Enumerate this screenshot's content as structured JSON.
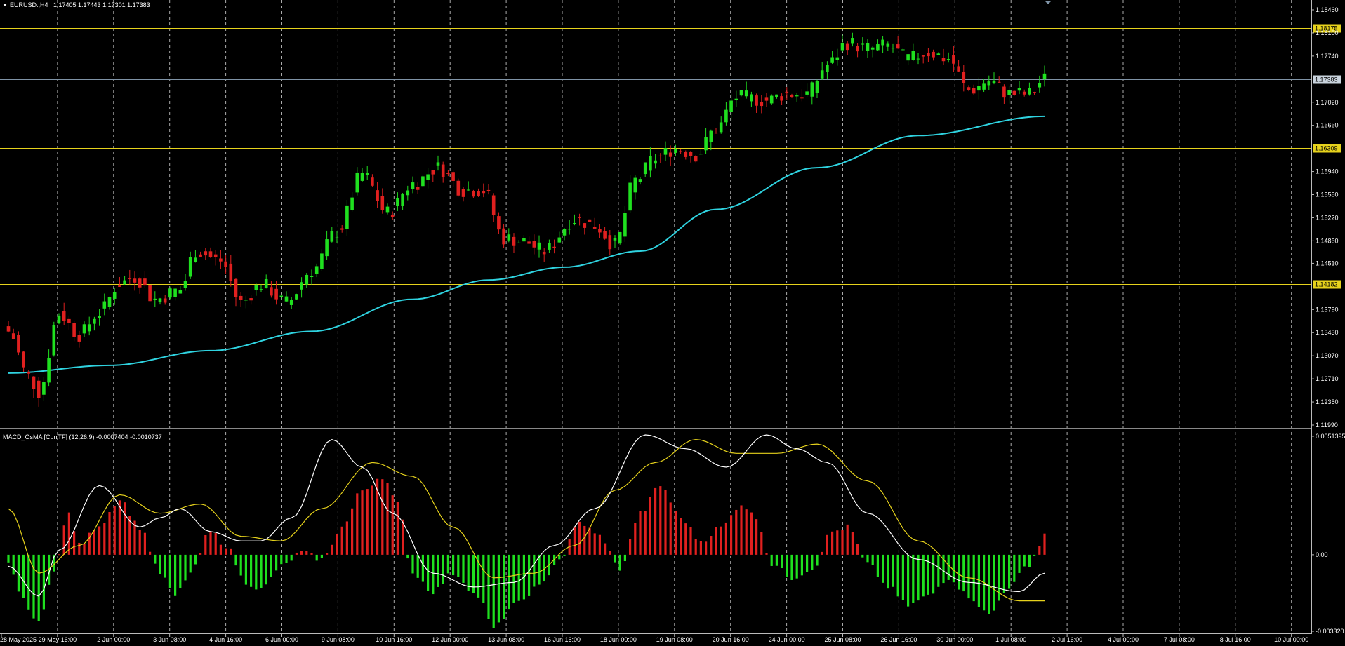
{
  "chart_header": {
    "symbol_label": "EURUSD.,H4",
    "ohlc_text": "1.17405 1.17443 1.17301 1.17383"
  },
  "indicator_header": {
    "label": "MACD_OsMA [CurrTF] (12,26,9) -0.0007404 -0.0010737"
  },
  "colors": {
    "background": "#000000",
    "bull_candle": "#1fe01f",
    "bear_candle": "#e0201f",
    "moving_average": "#2fd3e0",
    "level_line": "#e6d21c",
    "current_price_line": "#7f93a6",
    "grid": "#c8c8c8",
    "macd_line": "#ffffff",
    "signal_line": "#e6d21c",
    "hist_positive": "#e0201f",
    "hist_negative": "#1fe01f"
  },
  "chart_data": [
    {
      "type": "candlestick",
      "title": "EURUSD.,H4",
      "ylim": [
        1.1199,
        1.1846
      ],
      "y_ticks": [
        "1.18460",
        "1.18100",
        "1.17740",
        "1.17020",
        "1.16660",
        "1.15940",
        "1.15580",
        "1.15220",
        "1.14860",
        "1.14510",
        "1.13790",
        "1.13430",
        "1.13070",
        "1.12710",
        "1.12350",
        "1.11990"
      ],
      "horizontal_levels": [
        {
          "label": "1.18175",
          "value": 1.18175
        },
        {
          "label": "1.16309",
          "value": 1.16309
        },
        {
          "label": "1.14182",
          "value": 1.14182
        }
      ],
      "current_price": {
        "label": "1.17383",
        "value": 1.17383
      },
      "x_labels": [
        "28 May 2025",
        "29 May 16:00",
        "2 Jun 00:00",
        "3 Jun 08:00",
        "4 Jun 16:00",
        "6 Jun 00:00",
        "9 Jun 08:00",
        "10 Jun 16:00",
        "12 Jun 00:00",
        "13 Jun 08:00",
        "16 Jun 16:00",
        "18 Jun 00:00",
        "19 Jun 08:00",
        "20 Jun 16:00",
        "24 Jun 00:00",
        "25 Jun 08:00",
        "26 Jun 16:00",
        "30 Jun 00:00",
        "1 Jul 08:00",
        "2 Jul 16:00",
        "4 Jul 00:00",
        "7 Jul 08:00",
        "8 Jul 16:00",
        "10 Jul 00:00"
      ],
      "close_anchors": [
        {
          "bar": 0,
          "close": 1.1345
        },
        {
          "bar": 4,
          "close": 1.1275
        },
        {
          "bar": 6,
          "close": 1.125
        },
        {
          "bar": 10,
          "close": 1.1372
        },
        {
          "bar": 14,
          "close": 1.134
        },
        {
          "bar": 18,
          "close": 1.1375
        },
        {
          "bar": 22,
          "close": 1.142
        },
        {
          "bar": 25,
          "close": 1.143
        },
        {
          "bar": 29,
          "close": 1.1395
        },
        {
          "bar": 34,
          "close": 1.141
        },
        {
          "bar": 37,
          "close": 1.147
        },
        {
          "bar": 42,
          "close": 1.1455
        },
        {
          "bar": 46,
          "close": 1.139
        },
        {
          "bar": 50,
          "close": 1.1418
        },
        {
          "bar": 55,
          "close": 1.139
        },
        {
          "bar": 60,
          "close": 1.144
        },
        {
          "bar": 65,
          "close": 1.15
        },
        {
          "bar": 70,
          "close": 1.159
        },
        {
          "bar": 75,
          "close": 1.153
        },
        {
          "bar": 80,
          "close": 1.1575
        },
        {
          "bar": 85,
          "close": 1.16
        },
        {
          "bar": 90,
          "close": 1.1565
        },
        {
          "bar": 94,
          "close": 1.1565
        },
        {
          "bar": 98,
          "close": 1.149
        },
        {
          "bar": 102,
          "close": 1.1485
        },
        {
          "bar": 106,
          "close": 1.147
        },
        {
          "bar": 112,
          "close": 1.152
        },
        {
          "bar": 116,
          "close": 1.151
        },
        {
          "bar": 120,
          "close": 1.148
        },
        {
          "bar": 124,
          "close": 1.158
        },
        {
          "bar": 128,
          "close": 1.1615
        },
        {
          "bar": 132,
          "close": 1.163
        },
        {
          "bar": 136,
          "close": 1.162
        },
        {
          "bar": 140,
          "close": 1.166
        },
        {
          "bar": 144,
          "close": 1.171
        },
        {
          "bar": 150,
          "close": 1.1705
        },
        {
          "bar": 154,
          "close": 1.1715
        },
        {
          "bar": 158,
          "close": 1.1715
        },
        {
          "bar": 162,
          "close": 1.176
        },
        {
          "bar": 166,
          "close": 1.1795
        },
        {
          "bar": 170,
          "close": 1.1785
        },
        {
          "bar": 174,
          "close": 1.179
        },
        {
          "bar": 178,
          "close": 1.177
        },
        {
          "bar": 182,
          "close": 1.178
        },
        {
          "bar": 186,
          "close": 1.177
        },
        {
          "bar": 190,
          "close": 1.172
        },
        {
          "bar": 194,
          "close": 1.1735
        },
        {
          "bar": 198,
          "close": 1.1715
        },
        {
          "bar": 202,
          "close": 1.1715
        },
        {
          "bar": 205,
          "close": 1.17383
        }
      ],
      "moving_average_anchors": [
        {
          "bar": 0,
          "value": 1.128
        },
        {
          "bar": 20,
          "value": 1.1292
        },
        {
          "bar": 40,
          "value": 1.1315
        },
        {
          "bar": 60,
          "value": 1.1345
        },
        {
          "bar": 80,
          "value": 1.1395
        },
        {
          "bar": 95,
          "value": 1.1425
        },
        {
          "bar": 110,
          "value": 1.1445
        },
        {
          "bar": 125,
          "value": 1.147
        },
        {
          "bar": 140,
          "value": 1.1535
        },
        {
          "bar": 160,
          "value": 1.16
        },
        {
          "bar": 180,
          "value": 1.165
        },
        {
          "bar": 205,
          "value": 1.168
        }
      ],
      "bar_count": 206
    },
    {
      "type": "histogram",
      "title": "MACD_OsMA [CurrTF] (12,26,9)",
      "ylim": [
        -0.00332,
        0.005139
      ],
      "y_ticks": [
        "0.0051395",
        "0.00",
        "-0.003320"
      ],
      "osma_anchors": [
        {
          "bar": 0,
          "value": -0.0004
        },
        {
          "bar": 3,
          "value": -0.002
        },
        {
          "bar": 6,
          "value": -0.003
        },
        {
          "bar": 9,
          "value": -0.0006
        },
        {
          "bar": 12,
          "value": 0.0018
        },
        {
          "bar": 14,
          "value": 0.0004
        },
        {
          "bar": 18,
          "value": 0.0013
        },
        {
          "bar": 22,
          "value": 0.0024
        },
        {
          "bar": 26,
          "value": 0.0012
        },
        {
          "bar": 30,
          "value": -0.0008
        },
        {
          "bar": 33,
          "value": -0.0018
        },
        {
          "bar": 36,
          "value": -0.0008
        },
        {
          "bar": 40,
          "value": 0.001
        },
        {
          "bar": 43,
          "value": 0.0004
        },
        {
          "bar": 47,
          "value": -0.0012
        },
        {
          "bar": 50,
          "value": -0.0015
        },
        {
          "bar": 54,
          "value": -0.0005
        },
        {
          "bar": 58,
          "value": 0.0001
        },
        {
          "bar": 62,
          "value": -0.0002
        },
        {
          "bar": 66,
          "value": 0.0012
        },
        {
          "bar": 70,
          "value": 0.0028
        },
        {
          "bar": 74,
          "value": 0.0034
        },
        {
          "bar": 77,
          "value": 0.0022
        },
        {
          "bar": 80,
          "value": -0.0008
        },
        {
          "bar": 84,
          "value": -0.0016
        },
        {
          "bar": 88,
          "value": -0.0008
        },
        {
          "bar": 93,
          "value": -0.0018
        },
        {
          "bar": 96,
          "value": -0.0032
        },
        {
          "bar": 100,
          "value": -0.0022
        },
        {
          "bar": 105,
          "value": -0.0014
        },
        {
          "bar": 109,
          "value": -0.0002
        },
        {
          "bar": 113,
          "value": 0.0014
        },
        {
          "bar": 117,
          "value": 0.0008
        },
        {
          "bar": 121,
          "value": -0.0006
        },
        {
          "bar": 125,
          "value": 0.0018
        },
        {
          "bar": 129,
          "value": 0.003
        },
        {
          "bar": 133,
          "value": 0.0016
        },
        {
          "bar": 137,
          "value": 0.0006
        },
        {
          "bar": 141,
          "value": 0.0012
        },
        {
          "bar": 145,
          "value": 0.0022
        },
        {
          "bar": 148,
          "value": 0.0016
        },
        {
          "bar": 151,
          "value": -0.0004
        },
        {
          "bar": 155,
          "value": -0.001
        },
        {
          "bar": 159,
          "value": -0.0006
        },
        {
          "bar": 163,
          "value": 0.001
        },
        {
          "bar": 166,
          "value": 0.0012
        },
        {
          "bar": 170,
          "value": -0.0004
        },
        {
          "bar": 174,
          "value": -0.0014
        },
        {
          "bar": 178,
          "value": -0.0022
        },
        {
          "bar": 182,
          "value": -0.0018
        },
        {
          "bar": 186,
          "value": -0.001
        },
        {
          "bar": 190,
          "value": -0.0018
        },
        {
          "bar": 194,
          "value": -0.0026
        },
        {
          "bar": 198,
          "value": -0.0014
        },
        {
          "bar": 202,
          "value": -0.0004
        },
        {
          "bar": 204,
          "value": 0.0004
        },
        {
          "bar": 205,
          "value": 0.0009
        }
      ],
      "macd_anchors": [
        {
          "bar": 0,
          "value": -0.0005
        },
        {
          "bar": 6,
          "value": -0.0018
        },
        {
          "bar": 10,
          "value": 0.0002
        },
        {
          "bar": 18,
          "value": 0.003
        },
        {
          "bar": 26,
          "value": 0.0012
        },
        {
          "bar": 30,
          "value": 0.0016
        },
        {
          "bar": 34,
          "value": 0.002
        },
        {
          "bar": 40,
          "value": 0.001
        },
        {
          "bar": 46,
          "value": 0.0006
        },
        {
          "bar": 50,
          "value": 0.0006
        },
        {
          "bar": 56,
          "value": 0.0016
        },
        {
          "bar": 64,
          "value": 0.005
        },
        {
          "bar": 70,
          "value": 0.0038
        },
        {
          "bar": 76,
          "value": 0.0018
        },
        {
          "bar": 84,
          "value": -0.0008
        },
        {
          "bar": 92,
          "value": -0.0014
        },
        {
          "bar": 100,
          "value": -0.0012
        },
        {
          "bar": 108,
          "value": 0.0004
        },
        {
          "bar": 116,
          "value": 0.002
        },
        {
          "bar": 126,
          "value": 0.0052
        },
        {
          "bar": 134,
          "value": 0.0046
        },
        {
          "bar": 142,
          "value": 0.0038
        },
        {
          "bar": 150,
          "value": 0.0052
        },
        {
          "bar": 156,
          "value": 0.0046
        },
        {
          "bar": 162,
          "value": 0.004
        },
        {
          "bar": 170,
          "value": 0.0018
        },
        {
          "bar": 180,
          "value": -0.0002
        },
        {
          "bar": 190,
          "value": -0.0012
        },
        {
          "bar": 200,
          "value": -0.0016
        },
        {
          "bar": 205,
          "value": -0.0008
        }
      ],
      "signal_anchors": [
        {
          "bar": 0,
          "value": 0.002
        },
        {
          "bar": 6,
          "value": -0.0008
        },
        {
          "bar": 14,
          "value": 0.0004
        },
        {
          "bar": 22,
          "value": 0.0026
        },
        {
          "bar": 30,
          "value": 0.0018
        },
        {
          "bar": 38,
          "value": 0.0022
        },
        {
          "bar": 46,
          "value": 0.0008
        },
        {
          "bar": 54,
          "value": 0.0006
        },
        {
          "bar": 62,
          "value": 0.002
        },
        {
          "bar": 72,
          "value": 0.004
        },
        {
          "bar": 80,
          "value": 0.0034
        },
        {
          "bar": 88,
          "value": 0.0012
        },
        {
          "bar": 96,
          "value": -0.001
        },
        {
          "bar": 104,
          "value": -0.0008
        },
        {
          "bar": 112,
          "value": 0.0004
        },
        {
          "bar": 120,
          "value": 0.0028
        },
        {
          "bar": 128,
          "value": 0.004
        },
        {
          "bar": 136,
          "value": 0.005
        },
        {
          "bar": 144,
          "value": 0.0044
        },
        {
          "bar": 152,
          "value": 0.0044
        },
        {
          "bar": 160,
          "value": 0.0048
        },
        {
          "bar": 170,
          "value": 0.0032
        },
        {
          "bar": 180,
          "value": 0.0006
        },
        {
          "bar": 190,
          "value": -0.001
        },
        {
          "bar": 200,
          "value": -0.002
        },
        {
          "bar": 205,
          "value": -0.002
        }
      ]
    }
  ]
}
